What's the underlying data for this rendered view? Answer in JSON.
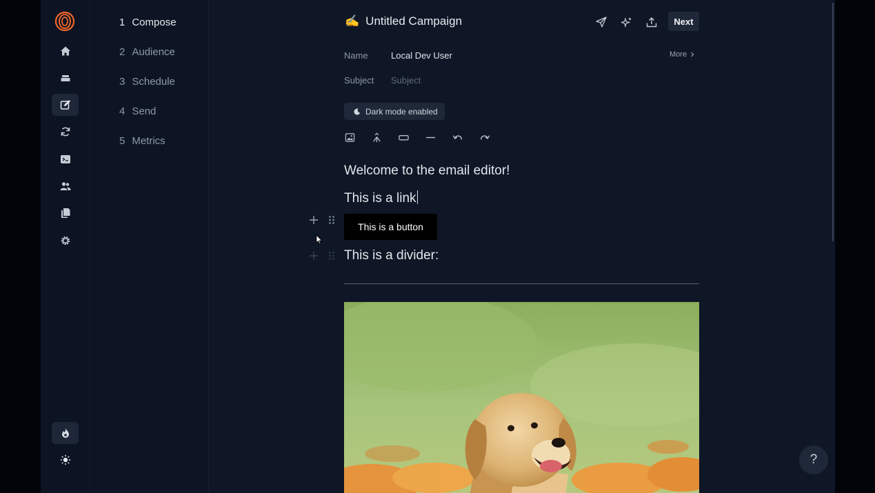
{
  "campaign": {
    "emoji": "✍️",
    "title": "Untitled Campaign"
  },
  "rail": {
    "items": [
      "logo-icon",
      "home-icon",
      "stack-icon",
      "compose-icon",
      "sync-icon",
      "terminal-icon",
      "users-icon",
      "documents-icon",
      "gear-icon"
    ],
    "bottom": [
      "flame-icon",
      "sun-icon"
    ]
  },
  "steps": [
    {
      "num": "1",
      "label": "Compose",
      "active": true
    },
    {
      "num": "2",
      "label": "Audience"
    },
    {
      "num": "3",
      "label": "Schedule"
    },
    {
      "num": "4",
      "label": "Send"
    },
    {
      "num": "5",
      "label": "Metrics"
    }
  ],
  "toolbar": {
    "next_label": "Next",
    "icons": [
      "send-icon",
      "sparkle-icon",
      "upload-icon"
    ]
  },
  "form": {
    "name_label": "Name",
    "name_value": "Local Dev User",
    "subject_label": "Subject",
    "subject_placeholder": "Subject",
    "more_label": "More"
  },
  "dark_mode": {
    "label": "Dark mode enabled"
  },
  "editor_tools": [
    "image-icon",
    "merge-icon",
    "button-block-icon",
    "divider-icon",
    "undo-icon",
    "redo-icon"
  ],
  "content": {
    "heading": "Welcome to the email editor!",
    "link_text": "This is a link",
    "button_text": "This is a button",
    "divider_text": "This is a divider:"
  },
  "help": {
    "label": "?"
  },
  "colors": {
    "brand": "#f2672a",
    "background": "#0f1726",
    "button": "#000000"
  }
}
